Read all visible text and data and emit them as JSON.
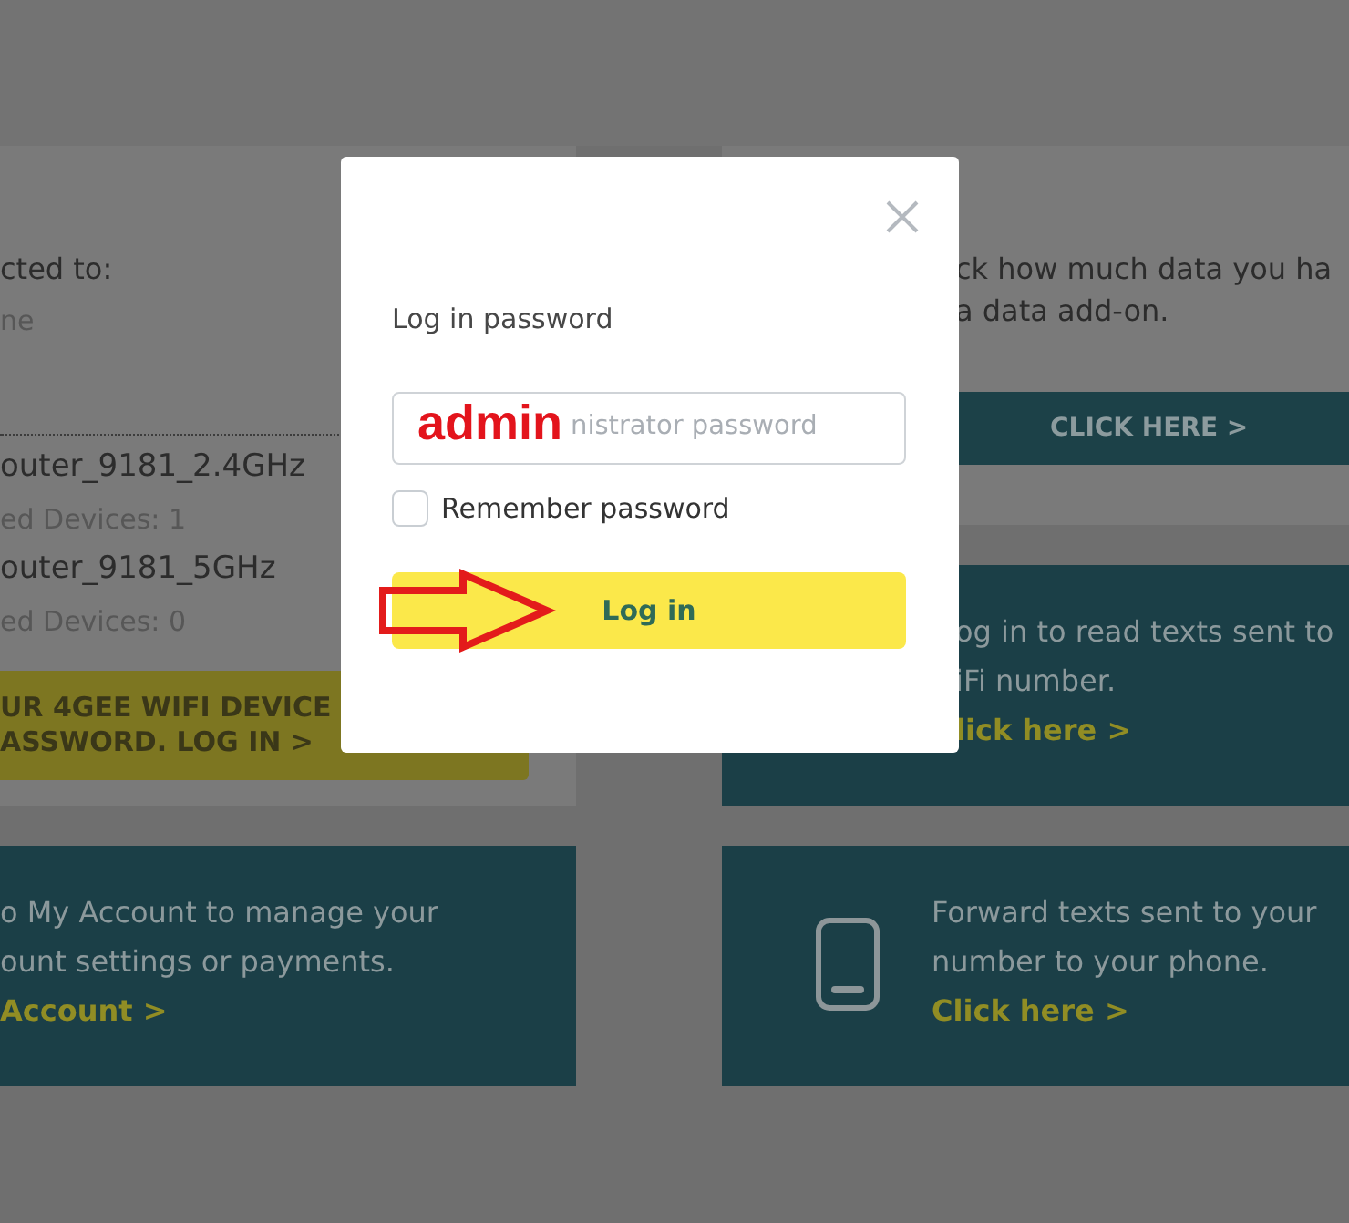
{
  "background": {
    "connection_card": {
      "heading": "cted to:",
      "status": "ne",
      "networks": [
        {
          "name": "outer_9181_2.4GHz",
          "devices": "ed Devices: 1"
        },
        {
          "name": "outer_9181_5GHz",
          "devices": "ed Devices: 0"
        }
      ],
      "banner_lines": [
        "UR 4GEE WIFI DEVICE",
        "ASSWORD. LOG IN >"
      ]
    },
    "data_card": {
      "lines": [
        "ck how much data you ha",
        "a data add-on."
      ],
      "button": "CLICK HERE >"
    },
    "promo_cards": [
      {
        "kind": "text",
        "lines": [
          "og in to read texts sent to",
          "iFi number."
        ],
        "link": "lick here >"
      },
      {
        "kind": "text",
        "lines": [
          "o My Account to manage your",
          "ount settings or payments."
        ],
        "link": "Account >"
      },
      {
        "kind": "icon_text",
        "text": "Forward texts sent to your number to your phone.",
        "link": "Click here >"
      }
    ]
  },
  "login_dialog": {
    "title": "Log in password",
    "password_field": {
      "placeholder": "nistrator password"
    },
    "remember_password": {
      "label": "Remember password",
      "checked": false
    },
    "button": "Log in"
  },
  "annotations": [
    {
      "kind": "text",
      "text": "admin"
    },
    {
      "kind": "arrow"
    }
  ]
}
